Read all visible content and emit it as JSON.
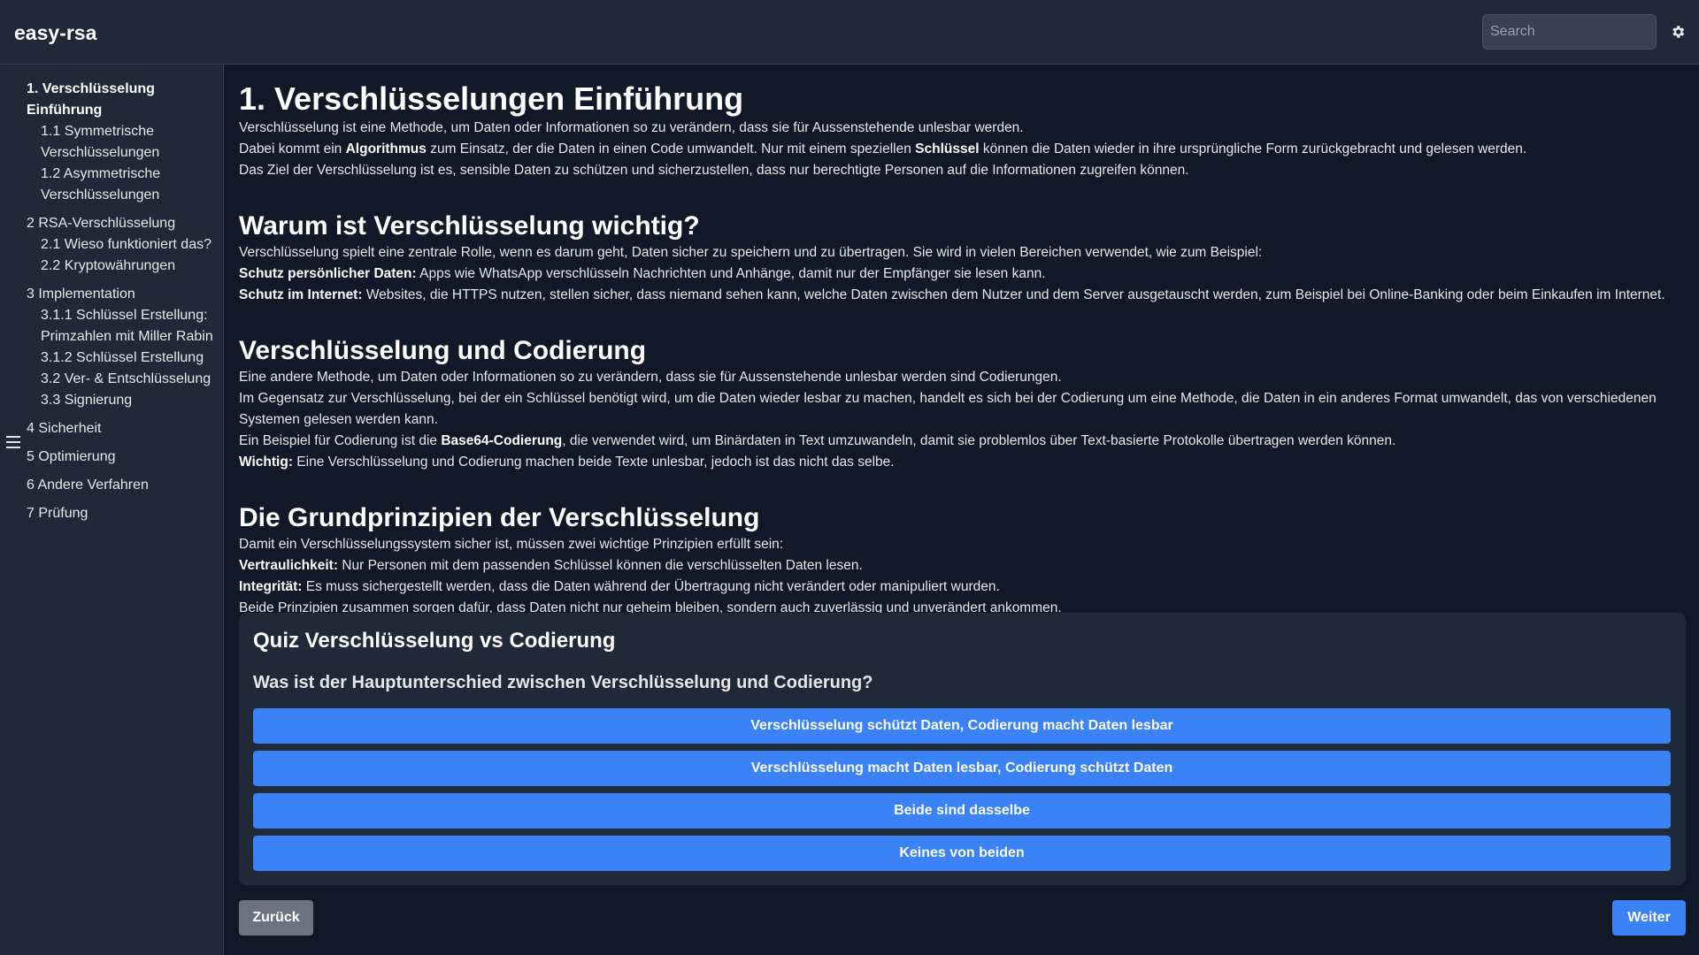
{
  "app": {
    "brand": "easy-rsa"
  },
  "header": {
    "search_placeholder": "Search",
    "settings_icon": "gear-icon"
  },
  "sidebar": {
    "menu_icon": "hamburger-menu-icon",
    "items": [
      {
        "label": "1. Verschlüsselung Einführung",
        "level": 1,
        "active": true
      },
      {
        "label": "1.1 Symmetrische Verschlüsselungen",
        "level": 2
      },
      {
        "label": "1.2 Asymmetrische Verschlüsselungen",
        "level": 2
      },
      {
        "label": "2 RSA-Verschlüsselung",
        "level": 1
      },
      {
        "label": "2.1 Wieso funktioniert das?",
        "level": 2
      },
      {
        "label": "2.2 Kryptowährungen",
        "level": 2
      },
      {
        "label": "3 Implementation",
        "level": 1
      },
      {
        "label": "3.1.1 Schlüssel Erstellung: Primzahlen mit Miller Rabin",
        "level": 2
      },
      {
        "label": "3.1.2 Schlüssel Erstellung",
        "level": 2
      },
      {
        "label": "3.2 Ver- & Entschlüsselung",
        "level": 2
      },
      {
        "label": "3.3 Signierung",
        "level": 2
      },
      {
        "label": "4 Sicherheit",
        "level": 1
      },
      {
        "label": "5 Optimierung",
        "level": 1
      },
      {
        "label": "6 Andere Verfahren",
        "level": 1
      },
      {
        "label": "7 Prüfung",
        "level": 1
      }
    ]
  },
  "content": {
    "title": "1. Verschlüsselungen Einführung",
    "intro": {
      "l1": "Verschlüsselung ist eine Methode, um Daten oder Informationen so zu verändern, dass sie für Aussenstehende unlesbar werden.",
      "l2a": "Dabei kommt ein ",
      "l2b": "Algorithmus",
      "l2c": " zum Einsatz, der die Daten in einen Code umwandelt. Nur mit einem speziellen ",
      "l2d": "Schlüssel",
      "l2e": " können die Daten wieder in ihre ursprüngliche Form zurückgebracht und gelesen werden.",
      "l3": "Das Ziel der Verschlüsselung ist es, sensible Daten zu schützen und sicherzustellen, dass nur berechtigte Personen auf die Informationen zugreifen können."
    },
    "why": {
      "heading": "Warum ist Verschlüsselung wichtig?",
      "l1": "Verschlüsselung spielt eine zentrale Rolle, wenn es darum geht, Daten sicher zu speichern und zu übertragen. Sie wird in vielen Bereichen verwendet, wie zum Beispiel:",
      "l2b": "Schutz persönlicher Daten:",
      "l2": " Apps wie WhatsApp verschlüsseln Nachrichten und Anhänge, damit nur der Empfänger sie lesen kann.",
      "l3b": "Schutz im Internet:",
      "l3": " Websites, die HTTPS nutzen, stellen sicher, dass niemand sehen kann, welche Daten zwischen dem Nutzer und dem Server ausgetauscht werden, zum Beispiel bei Online-Banking oder beim Einkaufen im Internet."
    },
    "coding": {
      "heading": "Verschlüsselung und Codierung",
      "l1": "Eine andere Methode, um Daten oder Informationen so zu verändern, dass sie für Aussenstehende unlesbar werden sind Codierungen.",
      "l2": "Im Gegensatz zur Verschlüsselung, bei der ein Schlüssel benötigt wird, um die Daten wieder lesbar zu machen, handelt es sich bei der Codierung um eine Methode, die Daten in ein anderes Format umwandelt, das von verschiedenen Systemen gelesen werden kann.",
      "l3a": "Ein Beispiel für Codierung ist die ",
      "l3b": "Base64-Codierung",
      "l3c": ", die verwendet wird, um Binärdaten in Text umzuwandeln, damit sie problemlos über Text-basierte Protokolle übertragen werden können.",
      "l4b": "Wichtig:",
      "l4": " Eine Verschlüsselung und Codierung machen beide Texte unlesbar, jedoch ist das nicht das selbe."
    },
    "principles": {
      "heading": "Die Grundprinzipien der Verschlüsselung",
      "l1": "Damit ein Verschlüsselungssystem sicher ist, müssen zwei wichtige Prinzipien erfüllt sein:",
      "l2b": "Vertraulichkeit:",
      "l2": " Nur Personen mit dem passenden Schlüssel können die verschlüsselten Daten lesen.",
      "l3b": "Integrität:",
      "l3": " Es muss sichergestellt werden, dass die Daten während der Übertragung nicht verändert oder manipuliert wurden.",
      "l4": "Beide Prinzipien zusammen sorgen dafür, dass Daten nicht nur geheim bleiben, sondern auch zuverlässig und unverändert ankommen."
    }
  },
  "quiz": {
    "title": "Quiz Verschlüsselung vs Codierung",
    "question": "Was ist der Hauptunterschied zwischen Verschlüsselung und Codierung?",
    "options": [
      "Verschlüsselung schützt Daten, Codierung macht Daten lesbar",
      "Verschlüsselung macht Daten lesbar, Codierung schützt Daten",
      "Beide sind dasselbe",
      "Keines von beiden"
    ]
  },
  "nav": {
    "back_label": "Zurück",
    "next_label": "Weiter"
  },
  "colors": {
    "background": "#111827",
    "panel": "#1f2937",
    "accent": "#3b82f6",
    "secondary_button": "#6b7280"
  }
}
